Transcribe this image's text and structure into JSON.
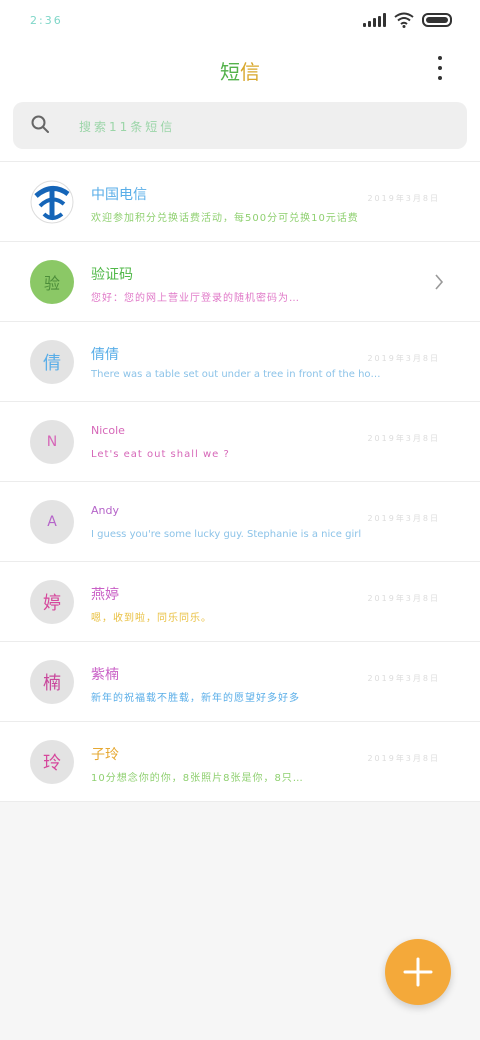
{
  "status_bar": {
    "time": "2:36"
  },
  "header": {
    "title_part1": "短",
    "title_part2": "信",
    "menu_icon": "more-vertical-icon"
  },
  "search": {
    "placeholder": "搜索11条短信",
    "icon": "search-icon"
  },
  "conversations": [
    {
      "name": "中国电信",
      "preview": "欢迎参加积分兑换话费活动，每500分可兑换10元话费",
      "time": "2019年3月8日",
      "avatar_text": "",
      "avatar_icon": "telecom-logo-icon",
      "name_color": "#5aaee8",
      "preview_color": "#8fd070"
    },
    {
      "name": "验证码",
      "preview": "您好：您的网上营业厅登录的随机密码为…",
      "time": "",
      "avatar_text": "验",
      "avatar_icon": "",
      "name_color": "#50b848",
      "preview_color": "#e079c8"
    },
    {
      "name": "倩倩",
      "preview": "There was a table set out under a tree in front of the house",
      "time": "2019年3月8日",
      "avatar_text": "倩",
      "avatar_icon": "",
      "name_color": "#5aaee8",
      "preview_color": "#8cc3e8"
    },
    {
      "name": "Nicole",
      "preview": "Let's eat out shall we ?",
      "time": "2019年3月8日",
      "avatar_text": "N",
      "avatar_icon": "",
      "name_color": "#d667b8",
      "preview_color": "#d667b8"
    },
    {
      "name": "Andy",
      "preview": "I guess you're some lucky guy. Stephanie is a nice girl",
      "time": "2019年3月8日",
      "avatar_text": "A",
      "avatar_icon": "",
      "name_color": "#b564c9",
      "preview_color": "#8cc3e8"
    },
    {
      "name": "燕婷",
      "preview": "嗯，收到啦，同乐同乐。",
      "time": "2019年3月8日",
      "avatar_text": "婷",
      "avatar_icon": "",
      "name_color": "#c95fc6",
      "preview_color": "#e9c040"
    },
    {
      "name": "紫楠",
      "preview": "新年的祝福载不胜载，新年的愿望好多好多",
      "time": "2019年3月8日",
      "avatar_text": "楠",
      "avatar_icon": "",
      "name_color": "#c95fc6",
      "preview_color": "#5aaee8"
    },
    {
      "name": "子玲",
      "preview": "10分想念你的你，8张照片8张是你，8只…",
      "time": "2019年3月8日",
      "avatar_text": "玲",
      "avatar_icon": "",
      "name_color": "#e6a832",
      "preview_color": "#8fd070"
    }
  ],
  "fab": {
    "icon": "plus-icon"
  },
  "colors": {
    "accent": "#f4a93a",
    "background": "#f6f6f6",
    "search_bg": "#efefef"
  }
}
